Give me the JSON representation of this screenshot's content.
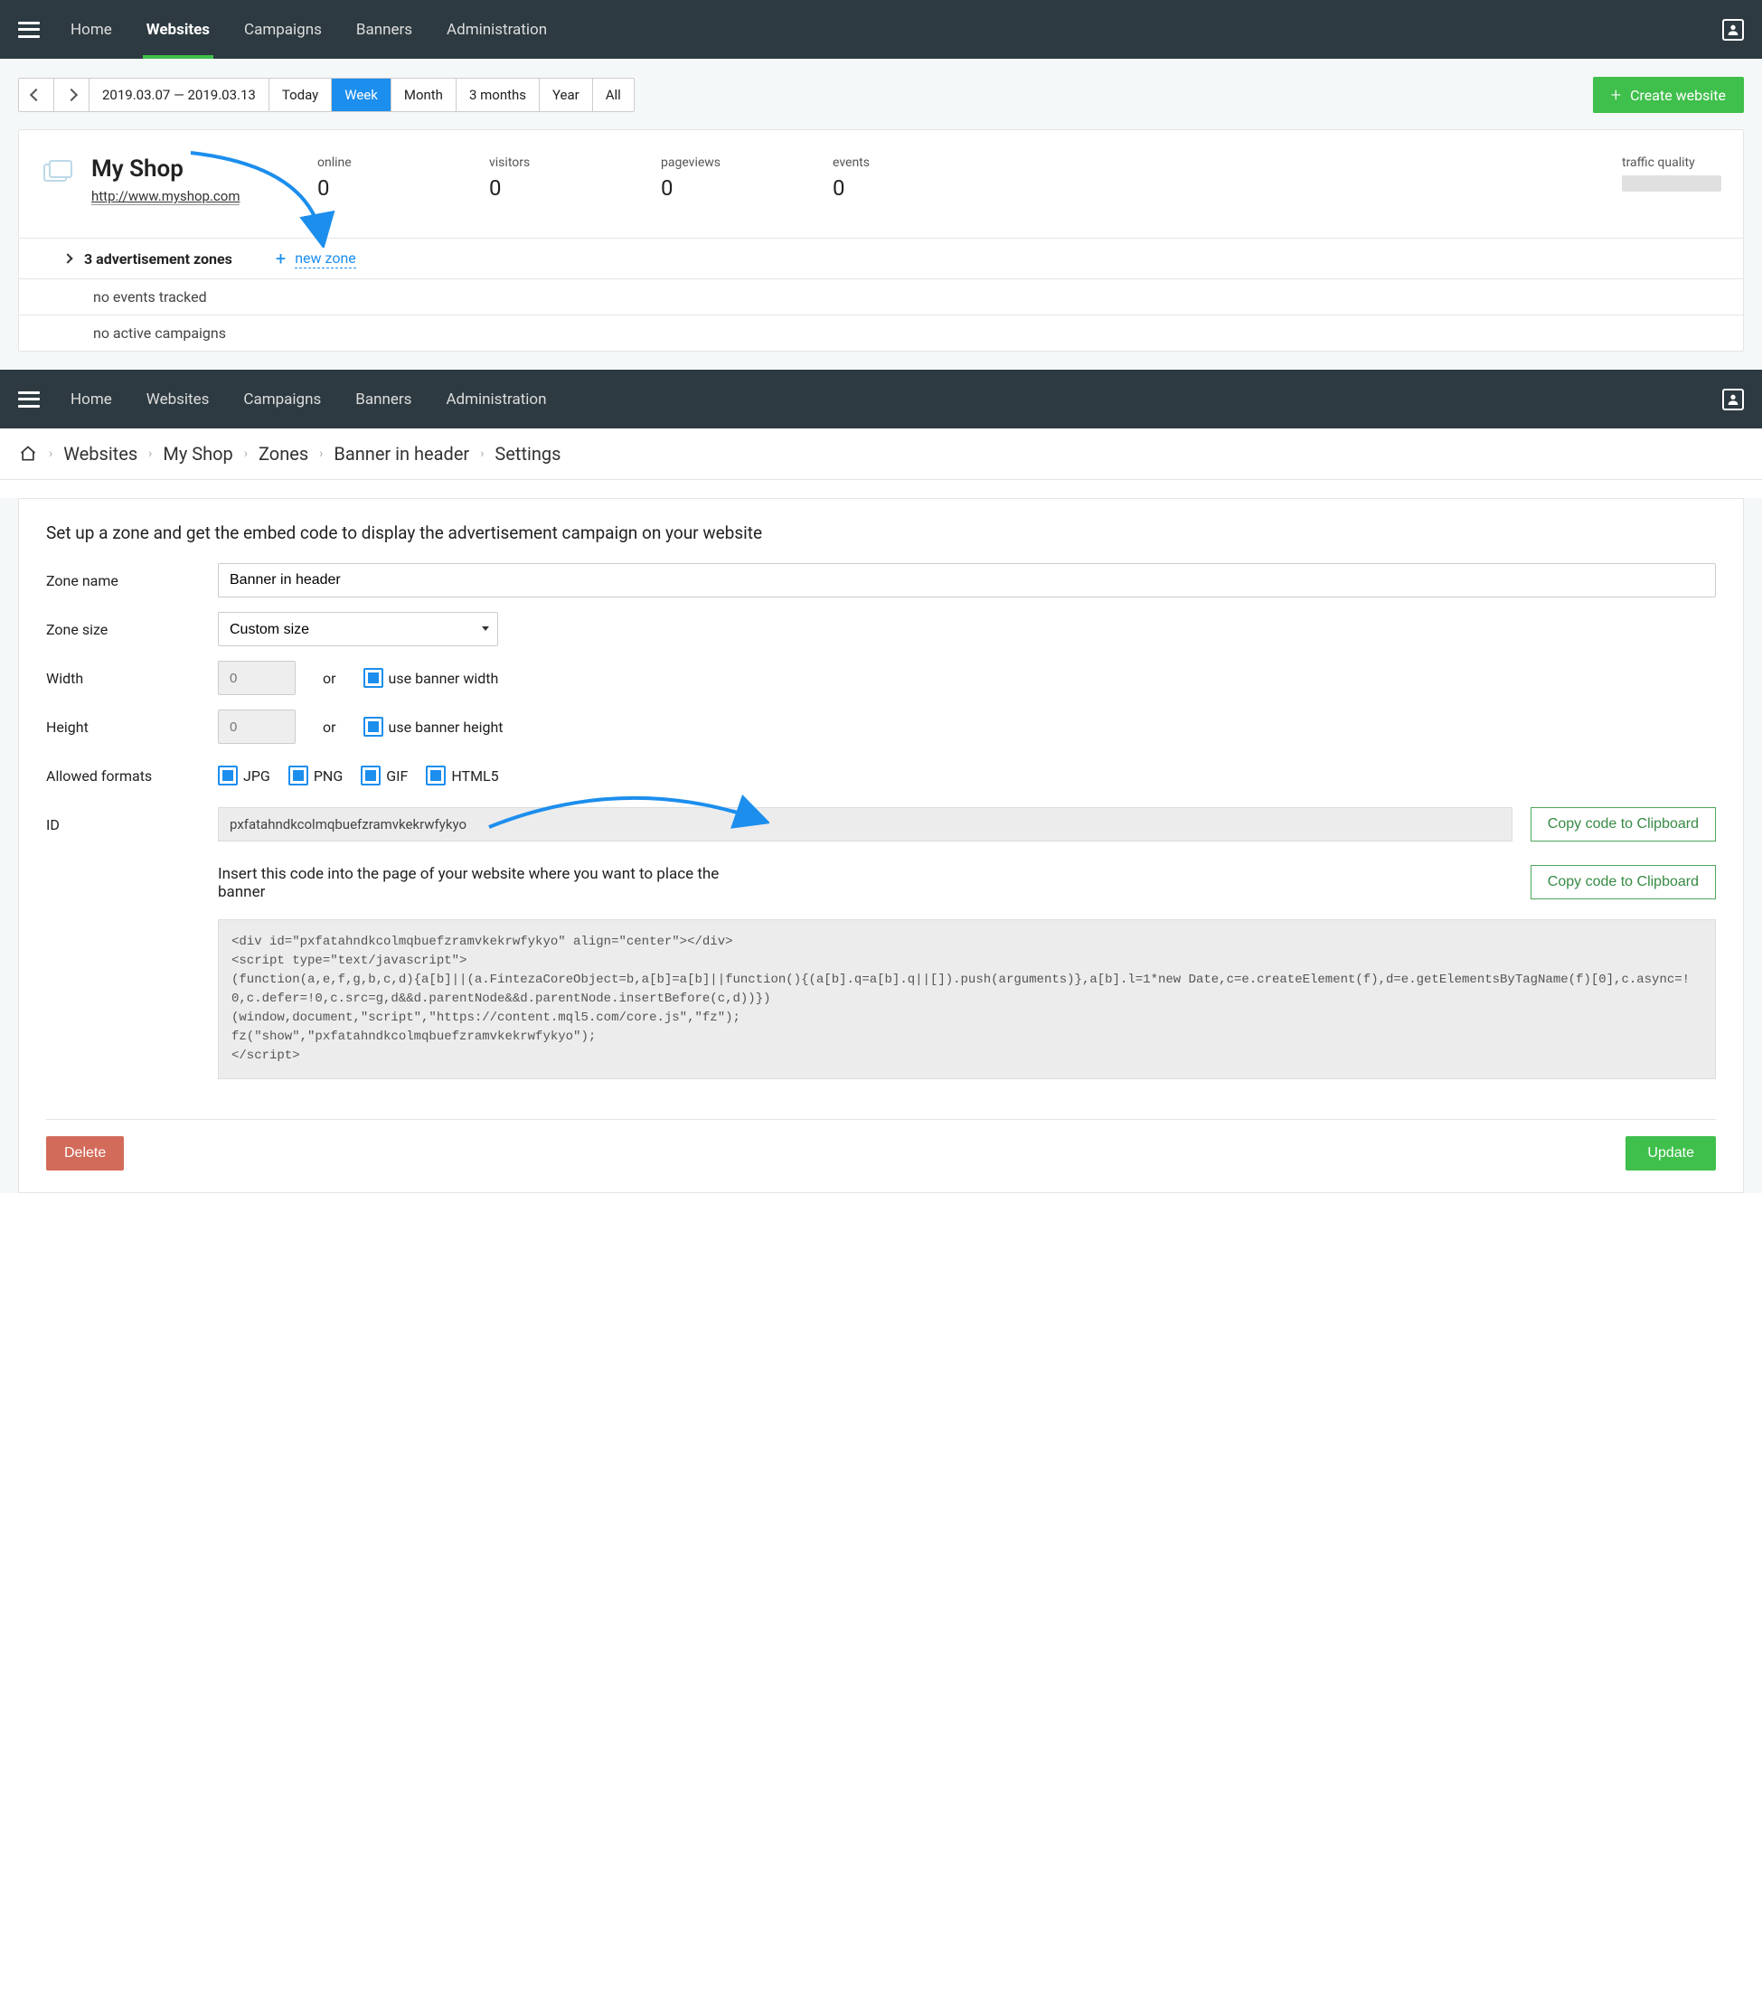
{
  "nav": {
    "items": [
      "Home",
      "Websites",
      "Campaigns",
      "Banners",
      "Administration"
    ],
    "active_index": 1
  },
  "toolbar": {
    "date_range": "2019.03.07  — 2019.03.13",
    "periods": [
      "Today",
      "Week",
      "Month",
      "3 months",
      "Year",
      "All"
    ],
    "active_period": 1,
    "create_label": "Create website"
  },
  "site": {
    "name": "My Shop",
    "url": "http://www.myshop.com",
    "stats": [
      {
        "label": "online",
        "value": "0"
      },
      {
        "label": "visitors",
        "value": "0"
      },
      {
        "label": "pageviews",
        "value": "0"
      },
      {
        "label": "events",
        "value": "0"
      }
    ],
    "traffic_quality_label": "traffic quality",
    "zones_label": "3 advertisement zones",
    "new_zone_label": "new zone",
    "sub_rows": [
      "no events tracked",
      "no active campaigns"
    ]
  },
  "nav2": {
    "items": [
      "Home",
      "Websites",
      "Campaigns",
      "Banners",
      "Administration"
    ]
  },
  "breadcrumb": [
    "Websites",
    "My Shop",
    "Zones",
    "Banner in header",
    "Settings"
  ],
  "settings": {
    "heading": "Set up a zone and get the embed code to display the advertisement campaign on your website",
    "labels": {
      "zone_name": "Zone name",
      "zone_size": "Zone size",
      "width": "Width",
      "height": "Height",
      "allowed_formats": "Allowed formats",
      "id": "ID"
    },
    "zone_name_value": "Banner in header",
    "zone_size_value": "Custom size",
    "width_placeholder": "0",
    "height_placeholder": "0",
    "or_label": "or",
    "use_width_label": "use banner width",
    "use_height_label": "use banner height",
    "formats": [
      "JPG",
      "PNG",
      "GIF",
      "HTML5"
    ],
    "id_value": "pxfatahndkcolmqbuefzramvkekrwfykyo",
    "copy_label": "Copy code to Clipboard",
    "instruction": "Insert this code into the page of your website where you want to place the banner",
    "code": "<div id=\"pxfatahndkcolmqbuefzramvkekrwfykyo\" align=\"center\"></div>\n<script type=\"text/javascript\">\n(function(a,e,f,g,b,c,d){a[b]||(a.FintezaCoreObject=b,a[b]=a[b]||function(){(a[b].q=a[b].q||[]).push(arguments)},a[b].l=1*new Date,c=e.createElement(f),d=e.getElementsByTagName(f)[0],c.async=!0,c.defer=!0,c.src=g,d&&d.parentNode&&d.parentNode.insertBefore(c,d))})\n(window,document,\"script\",\"https://content.mql5.com/core.js\",\"fz\");\nfz(\"show\",\"pxfatahndkcolmqbuefzramvkekrwfykyo\");\n</script>",
    "delete_label": "Delete",
    "update_label": "Update"
  }
}
